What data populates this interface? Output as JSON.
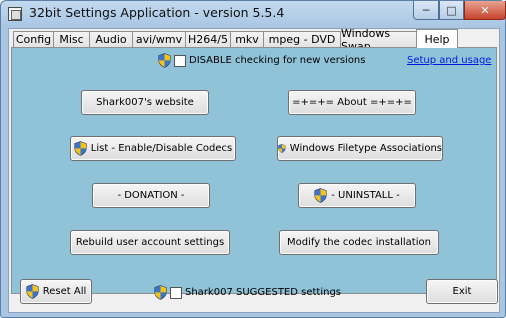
{
  "window": {
    "title": "32bit Settings Application - version 5.5.4"
  },
  "tabs": [
    {
      "label": "Config"
    },
    {
      "label": "Misc"
    },
    {
      "label": "Audio"
    },
    {
      "label": "avi/wmv"
    },
    {
      "label": "H264/5"
    },
    {
      "label": "mkv"
    },
    {
      "label": "mpeg - DVD"
    },
    {
      "label": "Windows Swap"
    },
    {
      "label": "Help",
      "active": true
    }
  ],
  "help": {
    "disable_check_label": "DISABLE checking for new versions",
    "setup_link": "Setup and usage",
    "website_button": "Shark007's website",
    "about_button": "=+=+= About =+=+=",
    "codecs_button": "List - Enable/Disable Codecs",
    "filetype_button": "Windows Filetype Associations",
    "donation_button": "- DONATION -",
    "uninstall_button": "- UNINSTALL -",
    "rebuild_button": "Rebuild user account settings",
    "modify_button": "Modify the codec installation"
  },
  "footer": {
    "reset_button": "Reset All",
    "suggested_label": "Shark007 SUGGESTED settings",
    "exit_button": "Exit"
  }
}
